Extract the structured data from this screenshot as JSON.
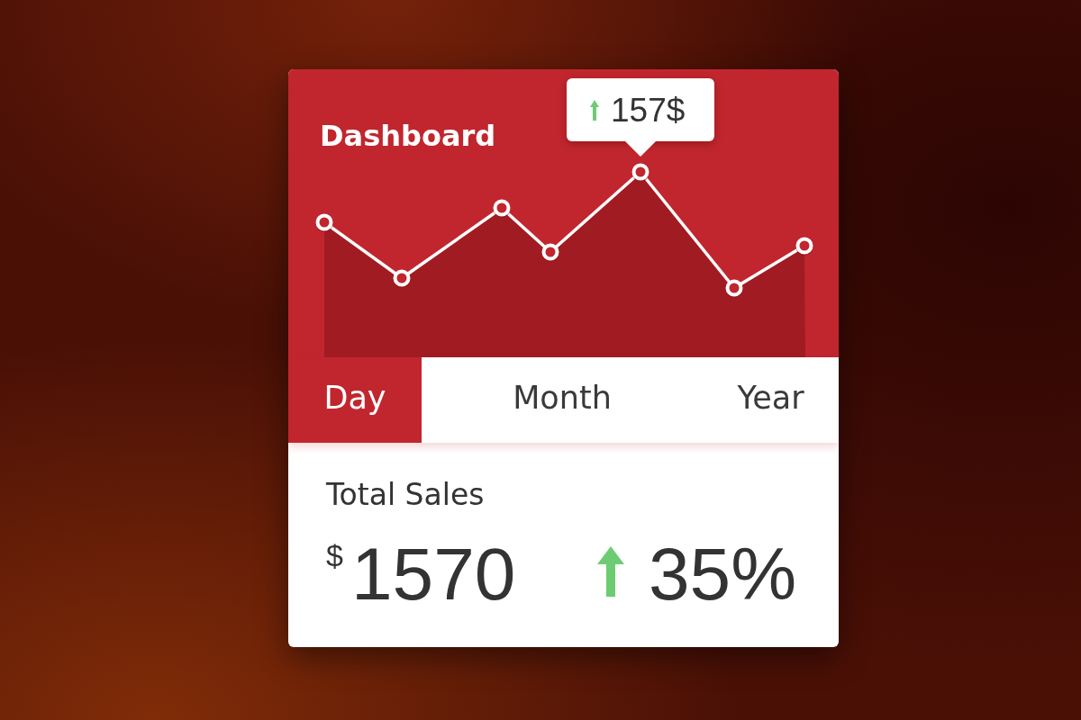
{
  "title": "Dashboard",
  "chart": {
    "tooltip": {
      "value": "157$",
      "rising": true
    }
  },
  "tabs": [
    {
      "label": "Day",
      "selected": true
    },
    {
      "label": "Month",
      "selected": false
    },
    {
      "label": "Year",
      "selected": false
    }
  ],
  "summary": {
    "label": "Total Sales",
    "currency": "$",
    "amount": "1570",
    "change": "35%",
    "rising": true
  }
}
